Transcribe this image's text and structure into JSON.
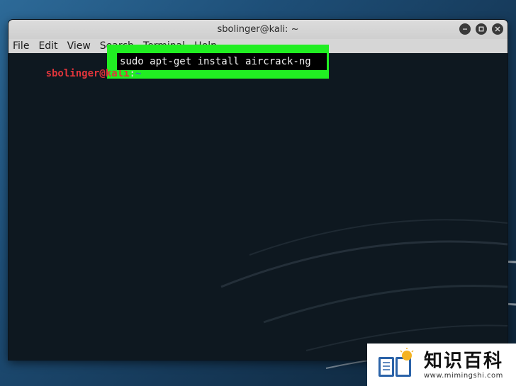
{
  "window": {
    "title": "sbolinger@kali: ~"
  },
  "menubar": {
    "items": [
      "File",
      "Edit",
      "View",
      "Search",
      "Terminal",
      "Help"
    ]
  },
  "terminal": {
    "prompt_user": "sbolinger@kali",
    "prompt_sep": ":",
    "prompt_path": "~",
    "command": "sudo apt-get install aircrack-ng",
    "highlight_color": "#21ee22"
  },
  "watermark": {
    "title": "知识百科",
    "url": "www.mimingshi.com"
  }
}
